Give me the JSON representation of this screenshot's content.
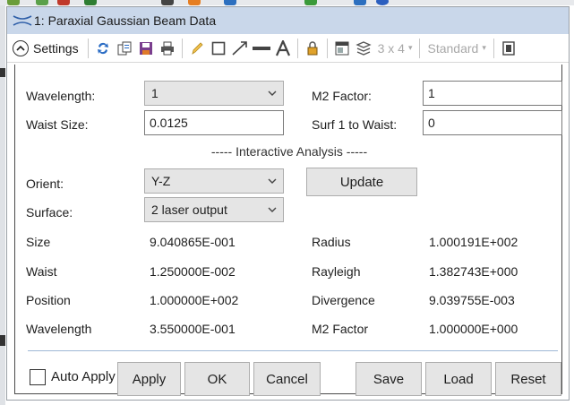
{
  "window": {
    "title": "1: Paraxial Gaussian Beam Data"
  },
  "toolbar": {
    "settings_label": "Settings",
    "layout_label": "3 x 4",
    "style_label": "Standard"
  },
  "inputs": {
    "wavelength": {
      "label": "Wavelength:",
      "value": "1"
    },
    "waist_size": {
      "label": "Waist Size:",
      "value": "0.0125"
    },
    "m2_factor": {
      "label": "M2 Factor:",
      "value": "1"
    },
    "surf1_to_waist": {
      "label": "Surf 1 to Waist:",
      "value": "0"
    }
  },
  "section_title": "----- Interactive Analysis -----",
  "interactive": {
    "orient": {
      "label": "Orient:",
      "value": "Y-Z"
    },
    "surface": {
      "label": "Surface:",
      "value": "2 laser output"
    },
    "update_label": "Update"
  },
  "results": {
    "left": [
      {
        "label": "Size",
        "value": "9.040865E-001"
      },
      {
        "label": "Waist",
        "value": "1.250000E-002"
      },
      {
        "label": "Position",
        "value": "1.000000E+002"
      },
      {
        "label": "Wavelength",
        "value": "3.550000E-001"
      }
    ],
    "right": [
      {
        "label": "Radius",
        "value": "1.000191E+002"
      },
      {
        "label": "Rayleigh",
        "value": "1.382743E+000"
      },
      {
        "label": "Divergence",
        "value": "9.039755E-003"
      },
      {
        "label": "M2 Factor",
        "value": "1.000000E+000"
      }
    ]
  },
  "footer": {
    "auto_apply_label": "Auto Apply",
    "auto_apply_checked": false,
    "apply": "Apply",
    "ok": "OK",
    "cancel": "Cancel",
    "save": "Save",
    "load": "Load",
    "reset": "Reset"
  },
  "colors": {
    "title_bar": "#c9d7ea",
    "button_face": "#e5e5e5",
    "divider": "#9fb8d6"
  }
}
